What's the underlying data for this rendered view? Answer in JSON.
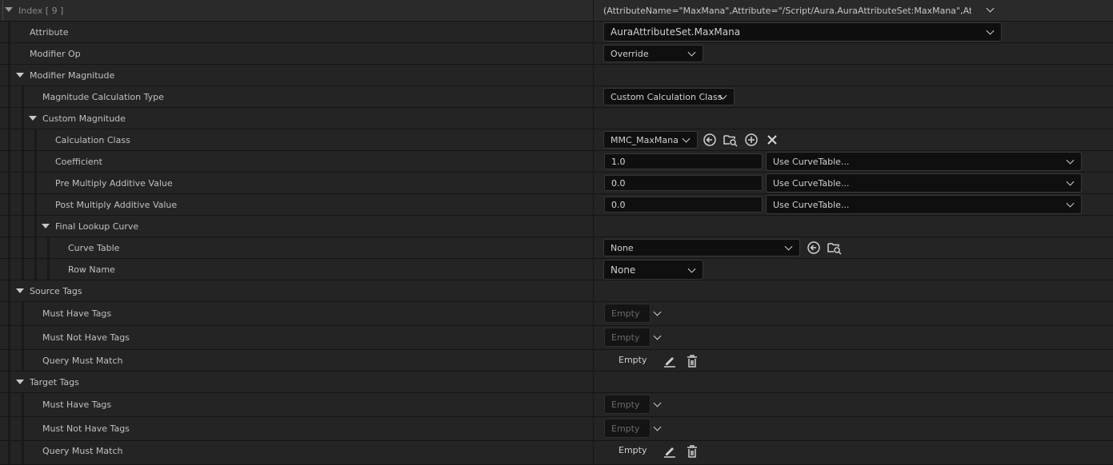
{
  "header": {
    "index_label": "Index [ 9 ]",
    "value": "(AttributeName=\"MaxMana\",Attribute=\"/Script/Aura.AuraAttributeSet:MaxMana\",AttributeO"
  },
  "rows": {
    "attribute": {
      "label": "Attribute",
      "value": "AuraAttributeSet.MaxMana"
    },
    "modifier_op": {
      "label": "Modifier Op",
      "value": "Override"
    },
    "modifier_magnitude": {
      "label": "Modifier Magnitude"
    },
    "magnitude_calc_type": {
      "label": "Magnitude Calculation Type",
      "value": "Custom Calculation Class"
    },
    "custom_magnitude": {
      "label": "Custom Magnitude"
    },
    "calculation_class": {
      "label": "Calculation Class",
      "value": "MMC_MaxMana"
    },
    "coefficient": {
      "label": "Coefficient",
      "value": "1.0",
      "curve": "Use CurveTable..."
    },
    "pre_multiply": {
      "label": "Pre Multiply Additive Value",
      "value": "0.0",
      "curve": "Use CurveTable..."
    },
    "post_multiply": {
      "label": "Post Multiply Additive Value",
      "value": "0.0",
      "curve": "Use CurveTable..."
    },
    "final_lookup_curve": {
      "label": "Final Lookup Curve"
    },
    "curve_table": {
      "label": "Curve Table",
      "value": "None"
    },
    "row_name": {
      "label": "Row Name",
      "value": "None"
    },
    "source_tags": {
      "label": "Source Tags"
    },
    "source_must_have": {
      "label": "Must Have Tags",
      "value": "Empty"
    },
    "source_must_not_have": {
      "label": "Must Not Have Tags",
      "value": "Empty"
    },
    "source_query": {
      "label": "Query Must Match",
      "value": "Empty"
    },
    "target_tags": {
      "label": "Target Tags"
    },
    "target_must_have": {
      "label": "Must Have Tags",
      "value": "Empty"
    },
    "target_must_not_have": {
      "label": "Must Not Have Tags",
      "value": "Empty"
    },
    "target_query": {
      "label": "Query Must Match",
      "value": "Empty"
    }
  },
  "icons": [
    "chevron-down-icon",
    "use-selected-icon",
    "browse-icon",
    "add-icon",
    "clear-icon",
    "edit-icon",
    "delete-icon"
  ]
}
